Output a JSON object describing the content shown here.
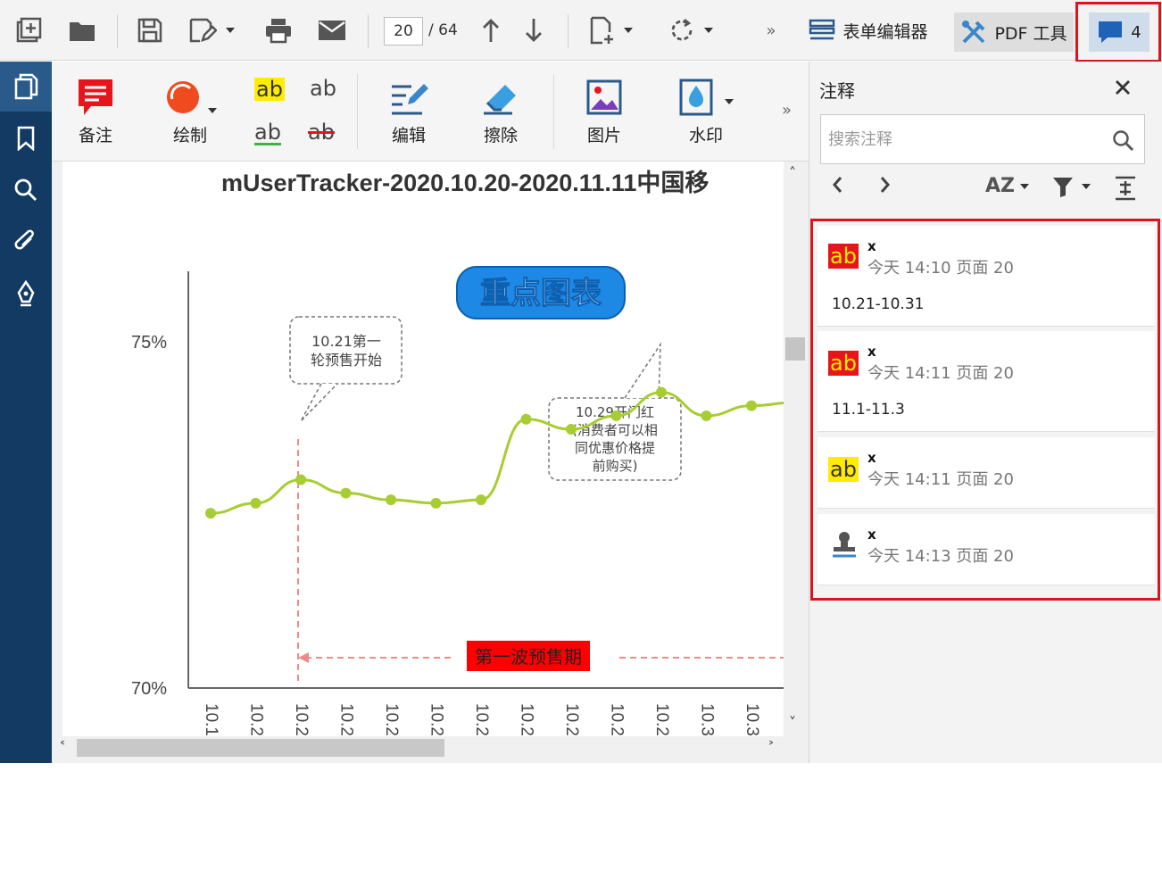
{
  "toolbar": {
    "page_current": "20",
    "page_total": "/ 64",
    "form_editor_label": "表单编辑器",
    "pdf_tools_label": "PDF 工具",
    "comments_count": "4",
    "more_label": "»"
  },
  "ribbon": {
    "note_label": "备注",
    "draw_label": "绘制",
    "highlight_label": "ab",
    "insert_label": "ab",
    "underline_label": "ab",
    "strike_label": "ab",
    "edit_label": "编辑",
    "erase_label": "擦除",
    "image_label": "图片",
    "watermark_label": "水印",
    "more_label": "»"
  },
  "document": {
    "title": "mUserTracker-2020.10.20-2020.11.11中国移",
    "badge": "重点图表",
    "callout1": [
      "10.21第一",
      "轮预售开始"
    ],
    "callout2": [
      "10.29开门红",
      "(消费者可以相",
      "同优惠价格提",
      "前购买)"
    ],
    "presale_label": "第一波预售期",
    "colors": {
      "line": "#a8cd32",
      "badge": "#1e88e5",
      "presale": "#ff0000"
    }
  },
  "chart_data": {
    "type": "line",
    "ylabel_ticks": [
      "75%",
      "70%"
    ],
    "x_tick_labels": [
      "10.1",
      "10.2",
      "10.2",
      "10.2",
      "10.2",
      "10.2",
      "10.2",
      "10.2",
      "10.2",
      "10.2",
      "10.2",
      "10.3",
      "10.3"
    ],
    "values": [
      72.6,
      72.75,
      73.1,
      72.9,
      72.8,
      72.75,
      72.8,
      74.0,
      73.85,
      74.05,
      74.4,
      74.05,
      74.2,
      74.25
    ],
    "ylim": [
      70,
      76.2
    ]
  },
  "panel": {
    "title": "注释",
    "search_placeholder": "搜索注释",
    "sort_label": "AZ",
    "comments": [
      {
        "type": "highlight-red",
        "icon_text": "ab",
        "author": "x",
        "meta": "今天 14:10  页面 20",
        "text": "10.21-10.31"
      },
      {
        "type": "highlight-red",
        "icon_text": "ab",
        "author": "x",
        "meta": "今天 14:11  页面 20",
        "text": "11.1-11.3"
      },
      {
        "type": "highlight-yellow",
        "icon_text": "ab",
        "author": "x",
        "meta": "今天 14:11  页面 20",
        "text": ""
      },
      {
        "type": "stamp",
        "icon_text": "",
        "author": "x",
        "meta": "今天 14:13  页面 20",
        "text": ""
      }
    ]
  }
}
